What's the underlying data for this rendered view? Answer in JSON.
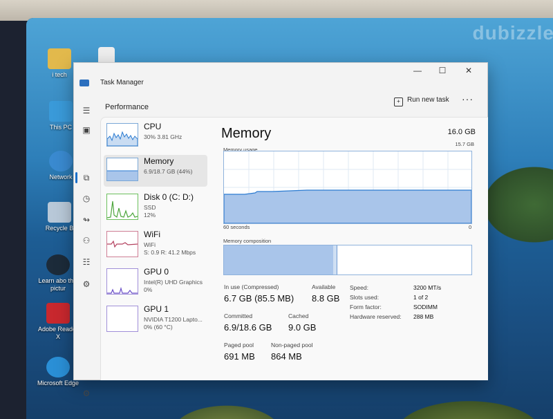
{
  "watermark": "dubizzle",
  "desktop_icons": [
    {
      "label": "i tech",
      "color": "#e2b94c"
    },
    {
      "label": "This PC",
      "color": "#3a9ad9"
    },
    {
      "label": "Network",
      "color": "#3a8ad0"
    },
    {
      "label": "Recycle B",
      "color": "#b8c8d8"
    },
    {
      "label": "Learn abo this pictur",
      "color": "#1c2b3a"
    },
    {
      "label": "Adobe Reader X",
      "color": "#c8282e"
    },
    {
      "label": "Microsoft Edge",
      "color": "#2a8fd6"
    }
  ],
  "window": {
    "title": "Task Manager",
    "minimize": "—",
    "maximize": "☐",
    "close": "✕"
  },
  "nav": {
    "menu_icon": "☰",
    "icons": [
      "▣",
      "⧉",
      "◷",
      "↬",
      "⚇",
      "☷",
      "⚙"
    ],
    "settings_icon": "⚙"
  },
  "header": {
    "page_title": "Performance",
    "run_new_task": "Run new task",
    "more": "···"
  },
  "perf_list": [
    {
      "name": "CPU",
      "sub": "30%  3.81 GHz",
      "color": "#2b7bd1"
    },
    {
      "name": "Memory",
      "sub": "6.9/18.7 GB (44%)",
      "color": "#2b7bd1"
    },
    {
      "name": "Disk 0 (C: D:)",
      "sub": "SSD",
      "sub2": "12%",
      "color": "#4ca53b"
    },
    {
      "name": "WiFi",
      "sub": "WiFi",
      "sub2": "S: 0.9  R: 41.2 Mbps",
      "color": "#b3405e"
    },
    {
      "name": "GPU 0",
      "sub": "Intel(R) UHD Graphics",
      "sub2": "0%",
      "color": "#6b4fc8"
    },
    {
      "name": "GPU 1",
      "sub": "NVIDIA T1200 Lapto...",
      "sub2": "0% (60 °C)",
      "color": "#6b4fc8"
    }
  ],
  "memory": {
    "title": "Memory",
    "total": "16.0 GB",
    "usage_label": "Memory usage",
    "usage_max": "15.7 GB",
    "time_label": "60 seconds",
    "zero_label": "0",
    "composition_label": "Memory composition",
    "in_use_fraction": 0.44,
    "stats": {
      "in_use_label": "In use (Compressed)",
      "in_use_value": "6.7 GB (85.5 MB)",
      "available_label": "Available",
      "available_value": "8.8 GB",
      "committed_label": "Committed",
      "committed_value": "6.9/18.6 GB",
      "cached_label": "Cached",
      "cached_value": "9.0 GB",
      "paged_label": "Paged pool",
      "paged_value": "691 MB",
      "nonpaged_label": "Non-paged pool",
      "nonpaged_value": "864 MB"
    },
    "details": [
      {
        "label": "Speed:",
        "value": "3200 MT/s"
      },
      {
        "label": "Slots used:",
        "value": "1 of 2"
      },
      {
        "label": "Form factor:",
        "value": "SODIMM"
      },
      {
        "label": "Hardware reserved:",
        "value": "288 MB"
      }
    ]
  }
}
